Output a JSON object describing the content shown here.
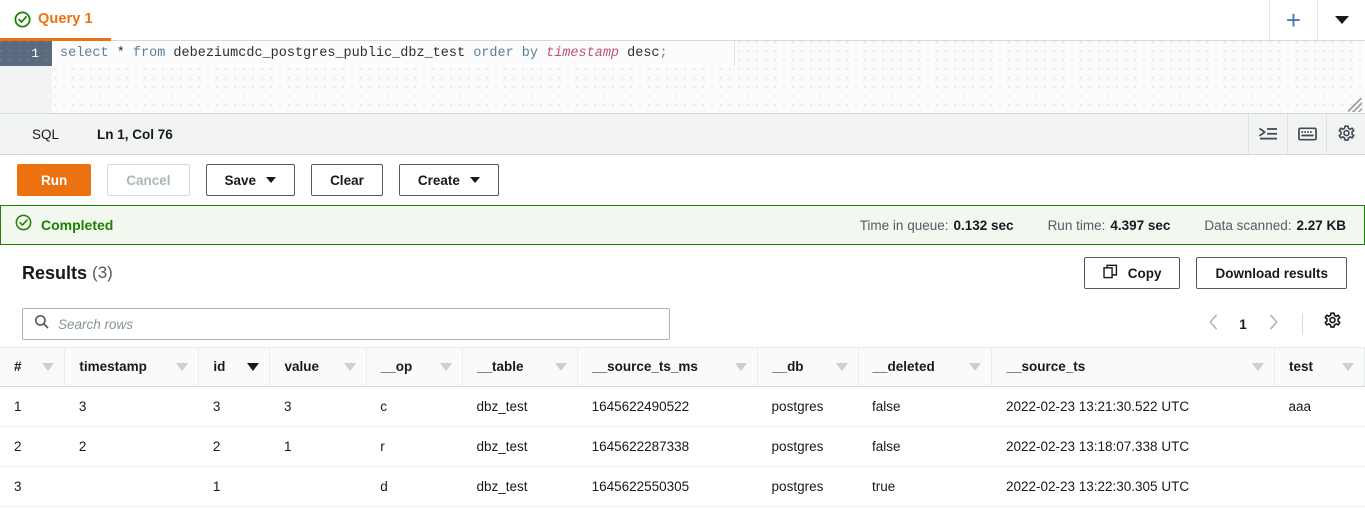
{
  "tab": {
    "label": "Query 1",
    "status_icon": "check-circle-icon",
    "new_tab_icon": "plus-icon",
    "overflow_icon": "caret-down-icon"
  },
  "editor": {
    "line_number": "1",
    "sql_tokens": [
      {
        "text": "select",
        "type": "keyword"
      },
      {
        "text": " * ",
        "type": "plain"
      },
      {
        "text": "from",
        "type": "keyword"
      },
      {
        "text": " debeziumcdc_postgres_public_dbz_test ",
        "type": "identifier"
      },
      {
        "text": "order by",
        "type": "keyword"
      },
      {
        "text": " ",
        "type": "plain"
      },
      {
        "text": "timestamp",
        "type": "type"
      },
      {
        "text": " desc",
        "type": "identifier"
      },
      {
        "text": ";",
        "type": "punctuation"
      }
    ],
    "sql_plain": "select * from debeziumcdc_postgres_public_dbz_test order by timestamp desc;",
    "resize_handle": "resize-grip"
  },
  "status_bar": {
    "language": "SQL",
    "cursor_position": "Ln 1, Col 76",
    "icons": [
      "format-indent-icon",
      "keyboard-shortcuts-icon",
      "settings-gear-icon"
    ]
  },
  "toolbar": {
    "run_label": "Run",
    "cancel_label": "Cancel",
    "save_label": "Save",
    "clear_label": "Clear",
    "create_label": "Create"
  },
  "banner": {
    "status": "Completed",
    "status_icon": "check-circle-icon",
    "accent_color": "#1d8102",
    "background_color": "#f2f8f0",
    "stats": [
      {
        "label": "Time in queue:",
        "value": "0.132 sec"
      },
      {
        "label": "Run time:",
        "value": "4.397 sec"
      },
      {
        "label": "Data scanned:",
        "value": "2.27 KB"
      }
    ]
  },
  "results": {
    "title": "Results",
    "count": "(3)",
    "copy_label": "Copy",
    "copy_icon": "copy-icon",
    "download_label": "Download results",
    "search_placeholder": "Search rows",
    "search_value": "",
    "search_icon": "search-icon",
    "prev_icon": "chevron-left-icon",
    "next_icon": "chevron-right-icon",
    "page_number": "1",
    "preferences_icon": "settings-gear-icon"
  },
  "table": {
    "columns": [
      {
        "key": "num",
        "label": "#",
        "sorted": false
      },
      {
        "key": "ts",
        "label": "timestamp",
        "sorted": false
      },
      {
        "key": "id",
        "label": "id",
        "sorted": true
      },
      {
        "key": "value",
        "label": "value",
        "sorted": false
      },
      {
        "key": "op",
        "label": "__op",
        "sorted": false
      },
      {
        "key": "table",
        "label": "__table",
        "sorted": false
      },
      {
        "key": "srcms",
        "label": "__source_ts_ms",
        "sorted": false
      },
      {
        "key": "db",
        "label": "__db",
        "sorted": false
      },
      {
        "key": "del",
        "label": "__deleted",
        "sorted": false
      },
      {
        "key": "srcts",
        "label": "__source_ts",
        "sorted": false
      },
      {
        "key": "test",
        "label": "test",
        "sorted": false
      }
    ],
    "rows": [
      {
        "num": "1",
        "ts": "3",
        "id": "3",
        "value": "3",
        "op": "c",
        "table": "dbz_test",
        "srcms": "1645622490522",
        "db": "postgres",
        "del": "false",
        "srcts": "2022-02-23 13:21:30.522 UTC",
        "test": "aaa"
      },
      {
        "num": "2",
        "ts": "2",
        "id": "2",
        "value": "1",
        "op": "r",
        "table": "dbz_test",
        "srcms": "1645622287338",
        "db": "postgres",
        "del": "false",
        "srcts": "2022-02-23 13:18:07.338 UTC",
        "test": ""
      },
      {
        "num": "3",
        "ts": "",
        "id": "1",
        "value": "",
        "op": "d",
        "table": "dbz_test",
        "srcms": "1645622550305",
        "db": "postgres",
        "del": "true",
        "srcts": "2022-02-23 13:22:30.305 UTC",
        "test": ""
      }
    ]
  },
  "colors": {
    "accent_orange": "#ec7211",
    "success_green": "#1d8102",
    "link_blue": "#4b77be",
    "text_dark": "#16191f",
    "text_muted": "#545b64"
  }
}
